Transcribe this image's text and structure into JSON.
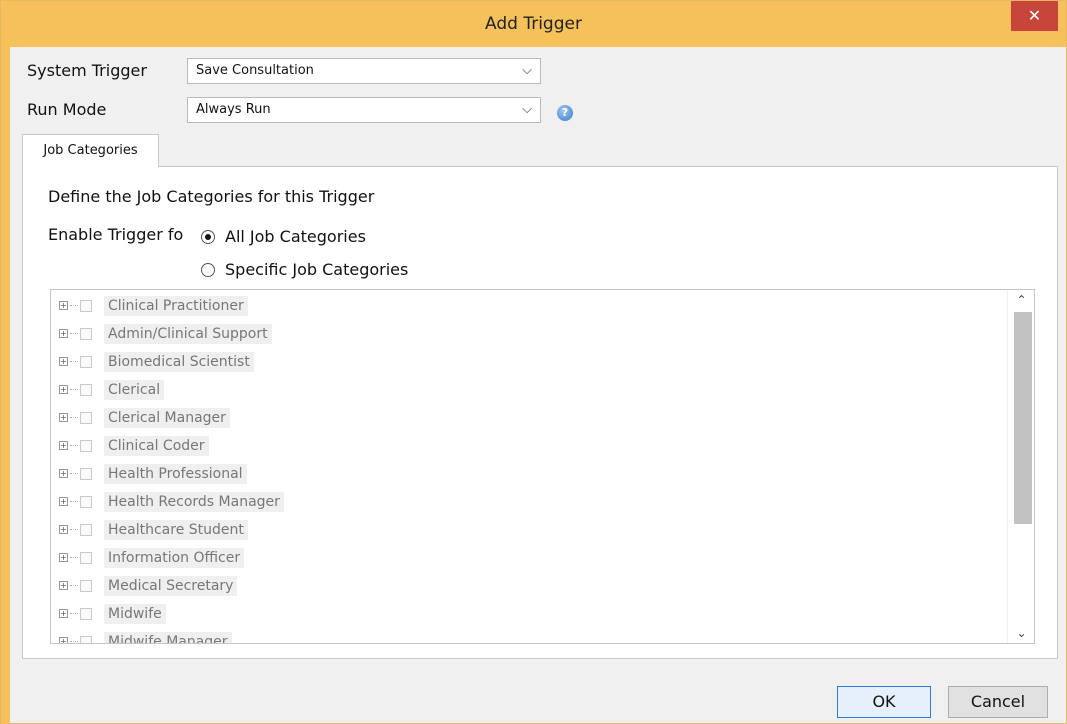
{
  "window": {
    "title": "Add Trigger",
    "close_glyph": "✕"
  },
  "form": {
    "system_trigger_label": "System Trigger",
    "system_trigger_value": "Save Consultation",
    "run_mode_label": "Run Mode",
    "run_mode_value": "Always Run",
    "help_glyph": "?"
  },
  "tabs": [
    {
      "label": "Job Categories",
      "selected": true
    }
  ],
  "panel": {
    "heading": "Define the Job Categories for this Trigger",
    "enable_label": "Enable Trigger fo",
    "radio_all": "All Job Categories",
    "radio_specific": "Specific Job Categories",
    "selected_option": "all"
  },
  "tree": {
    "items": [
      "Clinical Practitioner",
      "Admin/Clinical Support",
      "Biomedical Scientist",
      "Clerical",
      "Clerical Manager",
      "Clinical Coder",
      "Health Professional",
      "Health Records Manager",
      "Healthcare Student",
      "Information Officer",
      "Medical Secretary",
      "Midwife",
      "Midwife Manager"
    ]
  },
  "buttons": {
    "ok": "OK",
    "cancel": "Cancel"
  },
  "icons": {
    "chevron": "chevron-down-icon",
    "help": "help-icon",
    "close": "close-icon",
    "expand": "plus-expander-icon"
  },
  "colors": {
    "titlebar": "#f6c05a",
    "close_button": "#c7453a",
    "ok_border": "#2a7ad8"
  }
}
